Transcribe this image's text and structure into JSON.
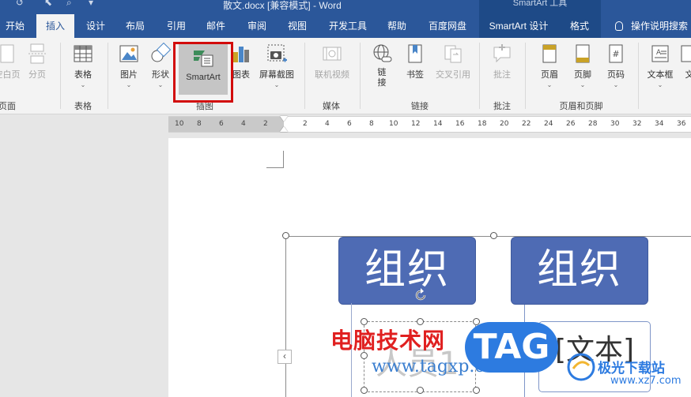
{
  "titlebar": {
    "document_title": "散文.docx [兼容模式]  -  Word",
    "context_title": "SmartArt 工具"
  },
  "tabs": [
    {
      "label": "开始"
    },
    {
      "label": "插入",
      "active": true
    },
    {
      "label": "设计"
    },
    {
      "label": "布局"
    },
    {
      "label": "引用"
    },
    {
      "label": "邮件"
    },
    {
      "label": "审阅"
    },
    {
      "label": "视图"
    },
    {
      "label": "开发工具"
    },
    {
      "label": "帮助"
    },
    {
      "label": "百度网盘"
    },
    {
      "label": "SmartArt 设计"
    },
    {
      "label": "格式"
    }
  ],
  "tell_me": "操作说明搜索",
  "ribbon": {
    "pages_group": {
      "label": "页面",
      "buttons": [
        "空白页",
        "分页"
      ]
    },
    "tables_group": {
      "label": "表格",
      "buttons": [
        "表格"
      ]
    },
    "illustrations_group": {
      "label": "插图",
      "buttons": [
        "图片",
        "形状",
        "SmartArt",
        "图表",
        "屏幕截图"
      ]
    },
    "media_group": {
      "label": "媒体",
      "buttons": [
        "联机视频"
      ]
    },
    "links_group": {
      "label": "链接",
      "buttons": [
        "链接",
        "书签",
        "交叉引用"
      ]
    },
    "comments_group": {
      "label": "批注",
      "buttons": [
        "批注"
      ]
    },
    "header_footer_group": {
      "label": "页眉和页脚",
      "buttons": [
        "页眉",
        "页脚",
        "页码"
      ]
    },
    "text_group": {
      "buttons": [
        "文本框",
        "文"
      ]
    }
  },
  "ruler": {
    "left_ticks": [
      "10",
      "8",
      "6",
      "4",
      "2"
    ],
    "right_ticks": [
      "2",
      "4",
      "6",
      "8",
      "10",
      "12",
      "14",
      "16",
      "18",
      "20",
      "22",
      "24",
      "26",
      "28",
      "30",
      "32",
      "34",
      "36"
    ]
  },
  "smartart": {
    "node_left": "组织",
    "node_right": "组织",
    "sub_left_placeholder": "人员1",
    "sub_right_placeholder": "[文本]"
  },
  "watermarks": {
    "site_name": "电脑技术网",
    "site_url": "www.tagxp.com",
    "tag": "TAG",
    "xz_name": "极光下载站",
    "xz_url": "www.xz7.com"
  },
  "colors": {
    "word_blue": "#2b579a",
    "shape_blue": "#4e6bb4",
    "highlight_red": "#d20b0b"
  }
}
